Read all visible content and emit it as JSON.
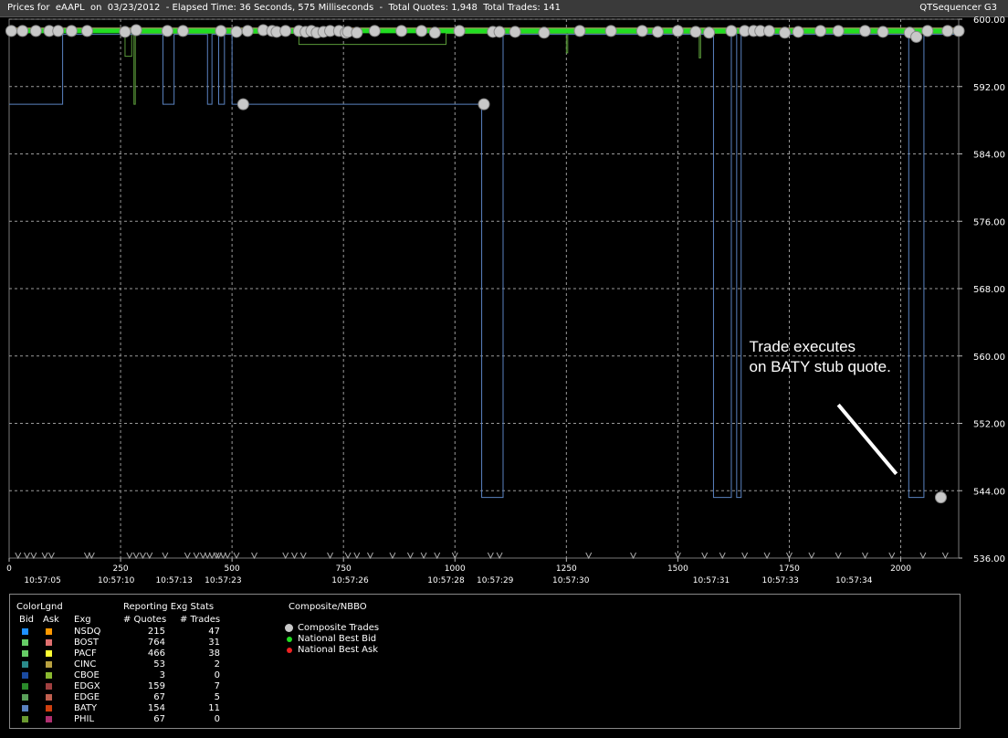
{
  "header": {
    "title": "Prices for  eAAPL  on  03/23/2012  - Elapsed Time: 36 Seconds, 575 Milliseconds  -  Total Quotes: 1,948  Total Trades: 141",
    "app_name": "QTSequencer G3"
  },
  "chart_data": {
    "type": "line",
    "y_ticks": [
      600.0,
      592.0,
      584.0,
      576.0,
      568.0,
      560.0,
      552.0,
      544.0,
      536.0
    ],
    "y_tick_labels": [
      "600.00",
      "592.00",
      "584.00",
      "576.00",
      "568.00",
      "560.00",
      "552.00",
      "544.00",
      "536.00"
    ],
    "ylim": [
      536,
      600
    ],
    "x_ticks": [
      0,
      250,
      500,
      750,
      1000,
      1250,
      1500,
      1750,
      2000
    ],
    "x_tick_labels": [
      "0",
      "250",
      "500",
      "750",
      "1000",
      "1250",
      "1500",
      "1750",
      "2000"
    ],
    "xlim": [
      0,
      2130
    ],
    "time_labels": [
      {
        "x": 75,
        "label": "10:57:05"
      },
      {
        "x": 240,
        "label": "10:57:10"
      },
      {
        "x": 370,
        "label": "10:57:13"
      },
      {
        "x": 480,
        "label": "10:57:23"
      },
      {
        "x": 765,
        "label": "10:57:26"
      },
      {
        "x": 980,
        "label": "10:57:28"
      },
      {
        "x": 1090,
        "label": "10:57:29"
      },
      {
        "x": 1260,
        "label": "10:57:30"
      },
      {
        "x": 1575,
        "label": "10:57:31"
      },
      {
        "x": 1730,
        "label": "10:57:33"
      },
      {
        "x": 1895,
        "label": "10:57:34"
      }
    ],
    "grid": true,
    "annotation": {
      "text_lines": [
        "Trade executes",
        "on BATY stub quote."
      ],
      "x": 1660,
      "y": 560.5
    },
    "annotation_arrow": {
      "x1": 1860,
      "y1": 554.2,
      "x2": 1990,
      "y2": 546.0
    },
    "national_best_bid": 598.6,
    "national_best_ask": 598.9,
    "baty_bid_steps": [
      [
        0,
        589.9
      ],
      [
        120,
        589.9
      ],
      [
        120,
        598.2
      ],
      [
        345,
        598.2
      ],
      [
        345,
        589.9
      ],
      [
        370,
        589.9
      ],
      [
        370,
        598.2
      ],
      [
        445,
        598.2
      ],
      [
        445,
        589.9
      ],
      [
        455,
        589.9
      ],
      [
        455,
        598.2
      ],
      [
        470,
        598.2
      ],
      [
        470,
        589.9
      ],
      [
        483,
        589.9
      ],
      [
        483,
        598.2
      ],
      [
        500,
        598.2
      ],
      [
        500,
        589.9
      ],
      [
        1060,
        589.9
      ],
      [
        1060,
        543.2
      ],
      [
        1108,
        543.2
      ],
      [
        1108,
        598.2
      ],
      [
        1580,
        598.2
      ],
      [
        1580,
        543.2
      ],
      [
        1620,
        543.2
      ],
      [
        1620,
        598.2
      ],
      [
        1632,
        598.2
      ],
      [
        1632,
        543.2
      ],
      [
        1642,
        543.2
      ],
      [
        1642,
        598.2
      ],
      [
        2018,
        598.2
      ],
      [
        2018,
        543.2
      ],
      [
        2052,
        543.2
      ],
      [
        2052,
        598.2
      ],
      [
        2130,
        598.2
      ]
    ],
    "secondary_bid_steps": [
      [
        260,
        598.3
      ],
      [
        260,
        595.6
      ],
      [
        275,
        595.6
      ],
      [
        275,
        598.3
      ],
      [
        280,
        598.3
      ],
      [
        280,
        589.9
      ],
      [
        283,
        589.9
      ],
      [
        283,
        598.3
      ],
      [
        650,
        598.3
      ],
      [
        650,
        597.0
      ],
      [
        980,
        597.0
      ],
      [
        980,
        598.3
      ],
      [
        1250,
        598.3
      ],
      [
        1250,
        596.0
      ],
      [
        1253,
        596.0
      ],
      [
        1253,
        598.3
      ],
      [
        1548,
        598.3
      ],
      [
        1548,
        595.4
      ],
      [
        1551,
        595.4
      ],
      [
        1551,
        598.3
      ],
      [
        2130,
        598.3
      ]
    ],
    "composite_trades": [
      [
        5,
        598.6
      ],
      [
        30,
        598.6
      ],
      [
        60,
        598.6
      ],
      [
        90,
        598.6
      ],
      [
        110,
        598.6
      ],
      [
        140,
        598.6
      ],
      [
        175,
        598.6
      ],
      [
        260,
        598.5
      ],
      [
        285,
        598.7
      ],
      [
        355,
        598.6
      ],
      [
        390,
        598.6
      ],
      [
        475,
        598.6
      ],
      [
        510,
        598.5
      ],
      [
        525,
        589.9
      ],
      [
        535,
        598.6
      ],
      [
        570,
        598.7
      ],
      [
        590,
        598.6
      ],
      [
        600,
        598.5
      ],
      [
        620,
        598.6
      ],
      [
        650,
        598.6
      ],
      [
        665,
        598.5
      ],
      [
        678,
        598.6
      ],
      [
        690,
        598.4
      ],
      [
        705,
        598.5
      ],
      [
        720,
        598.6
      ],
      [
        740,
        598.6
      ],
      [
        755,
        598.4
      ],
      [
        760,
        598.5
      ],
      [
        780,
        598.4
      ],
      [
        820,
        598.6
      ],
      [
        880,
        598.6
      ],
      [
        925,
        598.6
      ],
      [
        955,
        598.4
      ],
      [
        1010,
        598.6
      ],
      [
        1065,
        589.9
      ],
      [
        1085,
        598.5
      ],
      [
        1100,
        598.5
      ],
      [
        1135,
        598.5
      ],
      [
        1200,
        598.4
      ],
      [
        1280,
        598.6
      ],
      [
        1350,
        598.6
      ],
      [
        1420,
        598.6
      ],
      [
        1455,
        598.5
      ],
      [
        1500,
        598.6
      ],
      [
        1540,
        598.5
      ],
      [
        1570,
        598.4
      ],
      [
        1620,
        598.6
      ],
      [
        1650,
        598.6
      ],
      [
        1670,
        598.6
      ],
      [
        1685,
        598.6
      ],
      [
        1705,
        598.6
      ],
      [
        1740,
        598.4
      ],
      [
        1770,
        598.5
      ],
      [
        1820,
        598.6
      ],
      [
        1860,
        598.6
      ],
      [
        1920,
        598.6
      ],
      [
        1960,
        598.5
      ],
      [
        2020,
        598.4
      ],
      [
        2035,
        597.9
      ],
      [
        2060,
        598.6
      ],
      [
        2090,
        543.2
      ],
      [
        2105,
        598.6
      ],
      [
        2130,
        598.6
      ]
    ],
    "trade_markers_x": [
      20,
      40,
      55,
      80,
      95,
      175,
      185,
      270,
      285,
      300,
      315,
      350,
      400,
      420,
      435,
      445,
      455,
      465,
      470,
      480,
      490,
      510,
      550,
      620,
      640,
      660,
      720,
      760,
      780,
      810,
      860,
      900,
      930,
      960,
      1000,
      1080,
      1100,
      1300,
      1400,
      1500,
      1560,
      1600,
      1650,
      1700,
      1750,
      1800,
      1860,
      1920,
      1980,
      2050,
      2100
    ]
  },
  "legend": {
    "header_color": "ColorLgnd",
    "header_stats": "Reporting Exg Stats",
    "header_composite": "Composite/NBBO",
    "col_bid": "Bid",
    "col_ask": "Ask",
    "col_exg": "Exg",
    "col_quotes": "# Quotes",
    "col_trades": "# Trades",
    "rows": [
      {
        "exg": "NSDQ",
        "quotes": "215",
        "trades": "47",
        "bid_color": "#1e90ff",
        "ask_color": "#ff9900"
      },
      {
        "exg": "BOST",
        "quotes": "764",
        "trades": "31",
        "bid_color": "#66cc66",
        "ask_color": "#e07070"
      },
      {
        "exg": "PACF",
        "quotes": "466",
        "trades": "38",
        "bid_color": "#66cc66",
        "ask_color": "#ffff33"
      },
      {
        "exg": "CINC",
        "quotes": "53",
        "trades": "2",
        "bid_color": "#2a8a8a",
        "ask_color": "#b8a040"
      },
      {
        "exg": "CBOE",
        "quotes": "3",
        "trades": "0",
        "bid_color": "#1a4aa0",
        "ask_color": "#8ab830"
      },
      {
        "exg": "EDGX",
        "quotes": "159",
        "trades": "7",
        "bid_color": "#2a8a2a",
        "ask_color": "#a04040"
      },
      {
        "exg": "EDGE",
        "quotes": "67",
        "trades": "5",
        "bid_color": "#5aa05a",
        "ask_color": "#c06050"
      },
      {
        "exg": "BATY",
        "quotes": "154",
        "trades": "11",
        "bid_color": "#5a82c0",
        "ask_color": "#d04010"
      },
      {
        "exg": "PHIL",
        "quotes": "67",
        "trades": "0",
        "bid_color": "#6a9a30",
        "ask_color": "#b03070"
      }
    ],
    "composite_items": [
      {
        "label": "Composite Trades",
        "color": "#c8c8c8"
      },
      {
        "label": "National Best Bid",
        "color": "#22dd22"
      },
      {
        "label": "National Best Ask",
        "color": "#ee2222"
      }
    ]
  }
}
